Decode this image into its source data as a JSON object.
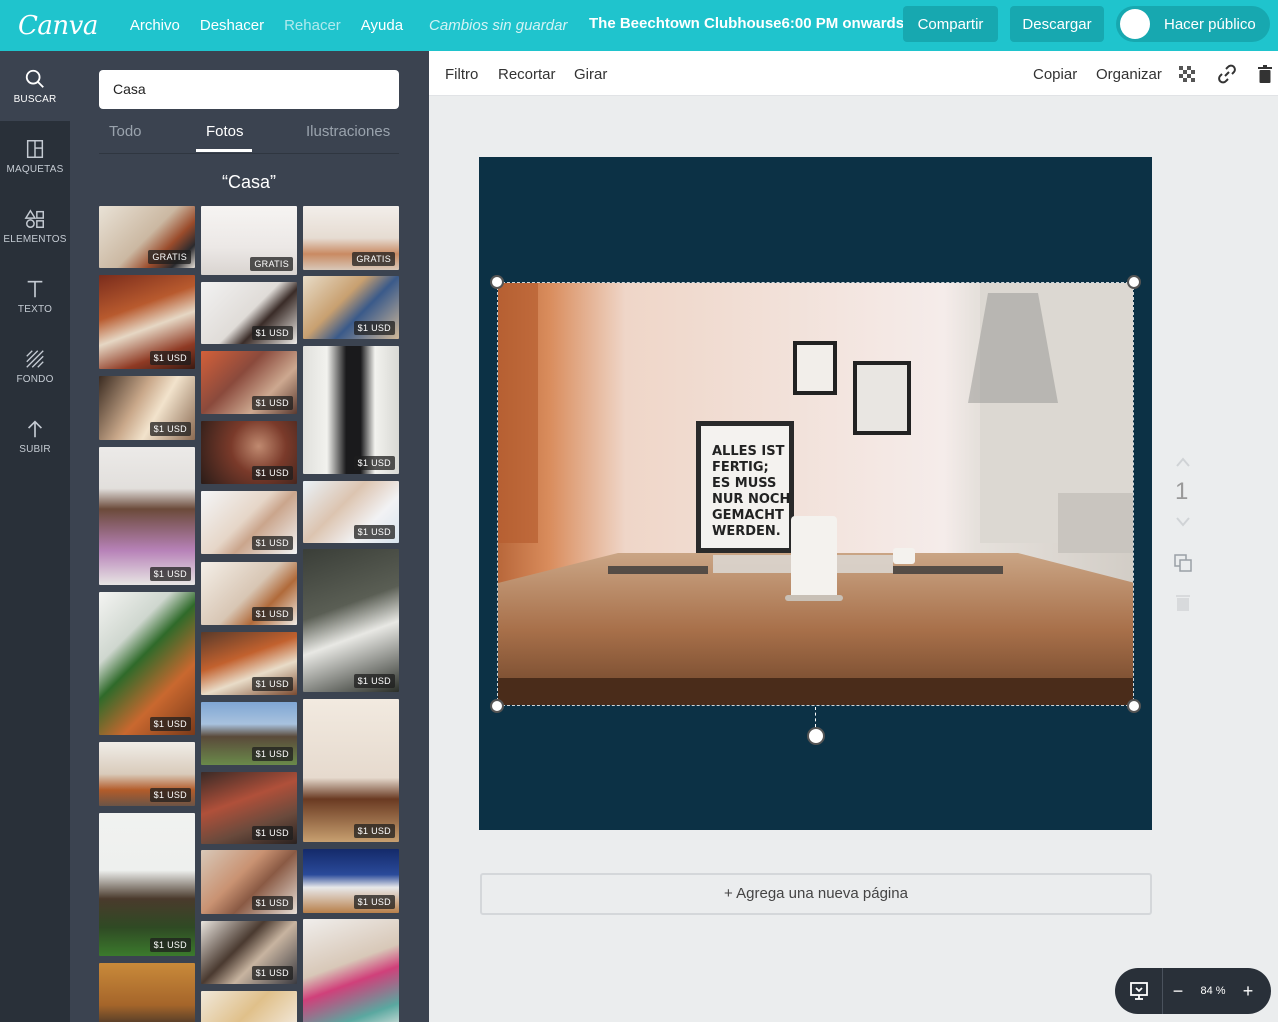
{
  "topbar": {
    "logo": "Canva",
    "menu": [
      "Archivo",
      "Deshacer",
      "Rehacer",
      "Ayuda"
    ],
    "unsaved": "Cambios sin guardar",
    "doc_title": "The Beechtown Clubhouse6:00 PM onwards",
    "share": "Compartir",
    "download": "Descargar",
    "make_public": "Hacer público"
  },
  "rail": [
    {
      "label": "BUSCAR",
      "icon": "search-icon"
    },
    {
      "label": "MAQUETAS",
      "icon": "layout-icon"
    },
    {
      "label": "ELEMENTOS",
      "icon": "shapes-icon"
    },
    {
      "label": "TEXTO",
      "icon": "text-icon"
    },
    {
      "label": "FONDO",
      "icon": "background-icon"
    },
    {
      "label": "SUBIR",
      "icon": "upload-icon"
    }
  ],
  "panel": {
    "search_value": "Casa",
    "tabs": [
      "Todo",
      "Fotos",
      "Ilustraciones"
    ],
    "active_tab": "Fotos",
    "query_label": "“Casa”",
    "badge_free": "GRATIS",
    "badge_paid": "$1 USD"
  },
  "toolbar": {
    "filter": "Filtro",
    "crop": "Recortar",
    "flip": "Girar",
    "copy": "Copiar",
    "arrange": "Organizar"
  },
  "canvas": {
    "page_number": "1",
    "poster_text": "ALLES IST FERTIG; ES MUSS NUR NOCH GEMACHT WERDEN.",
    "add_page": "+ Agrega una nueva página",
    "page_color": "#0c3145"
  },
  "zoom": {
    "minus": "−",
    "value": "84 %",
    "plus": "+"
  },
  "colors": {
    "accent": "#1fc4cd",
    "rail": "#293039",
    "panel": "#3b4350"
  }
}
